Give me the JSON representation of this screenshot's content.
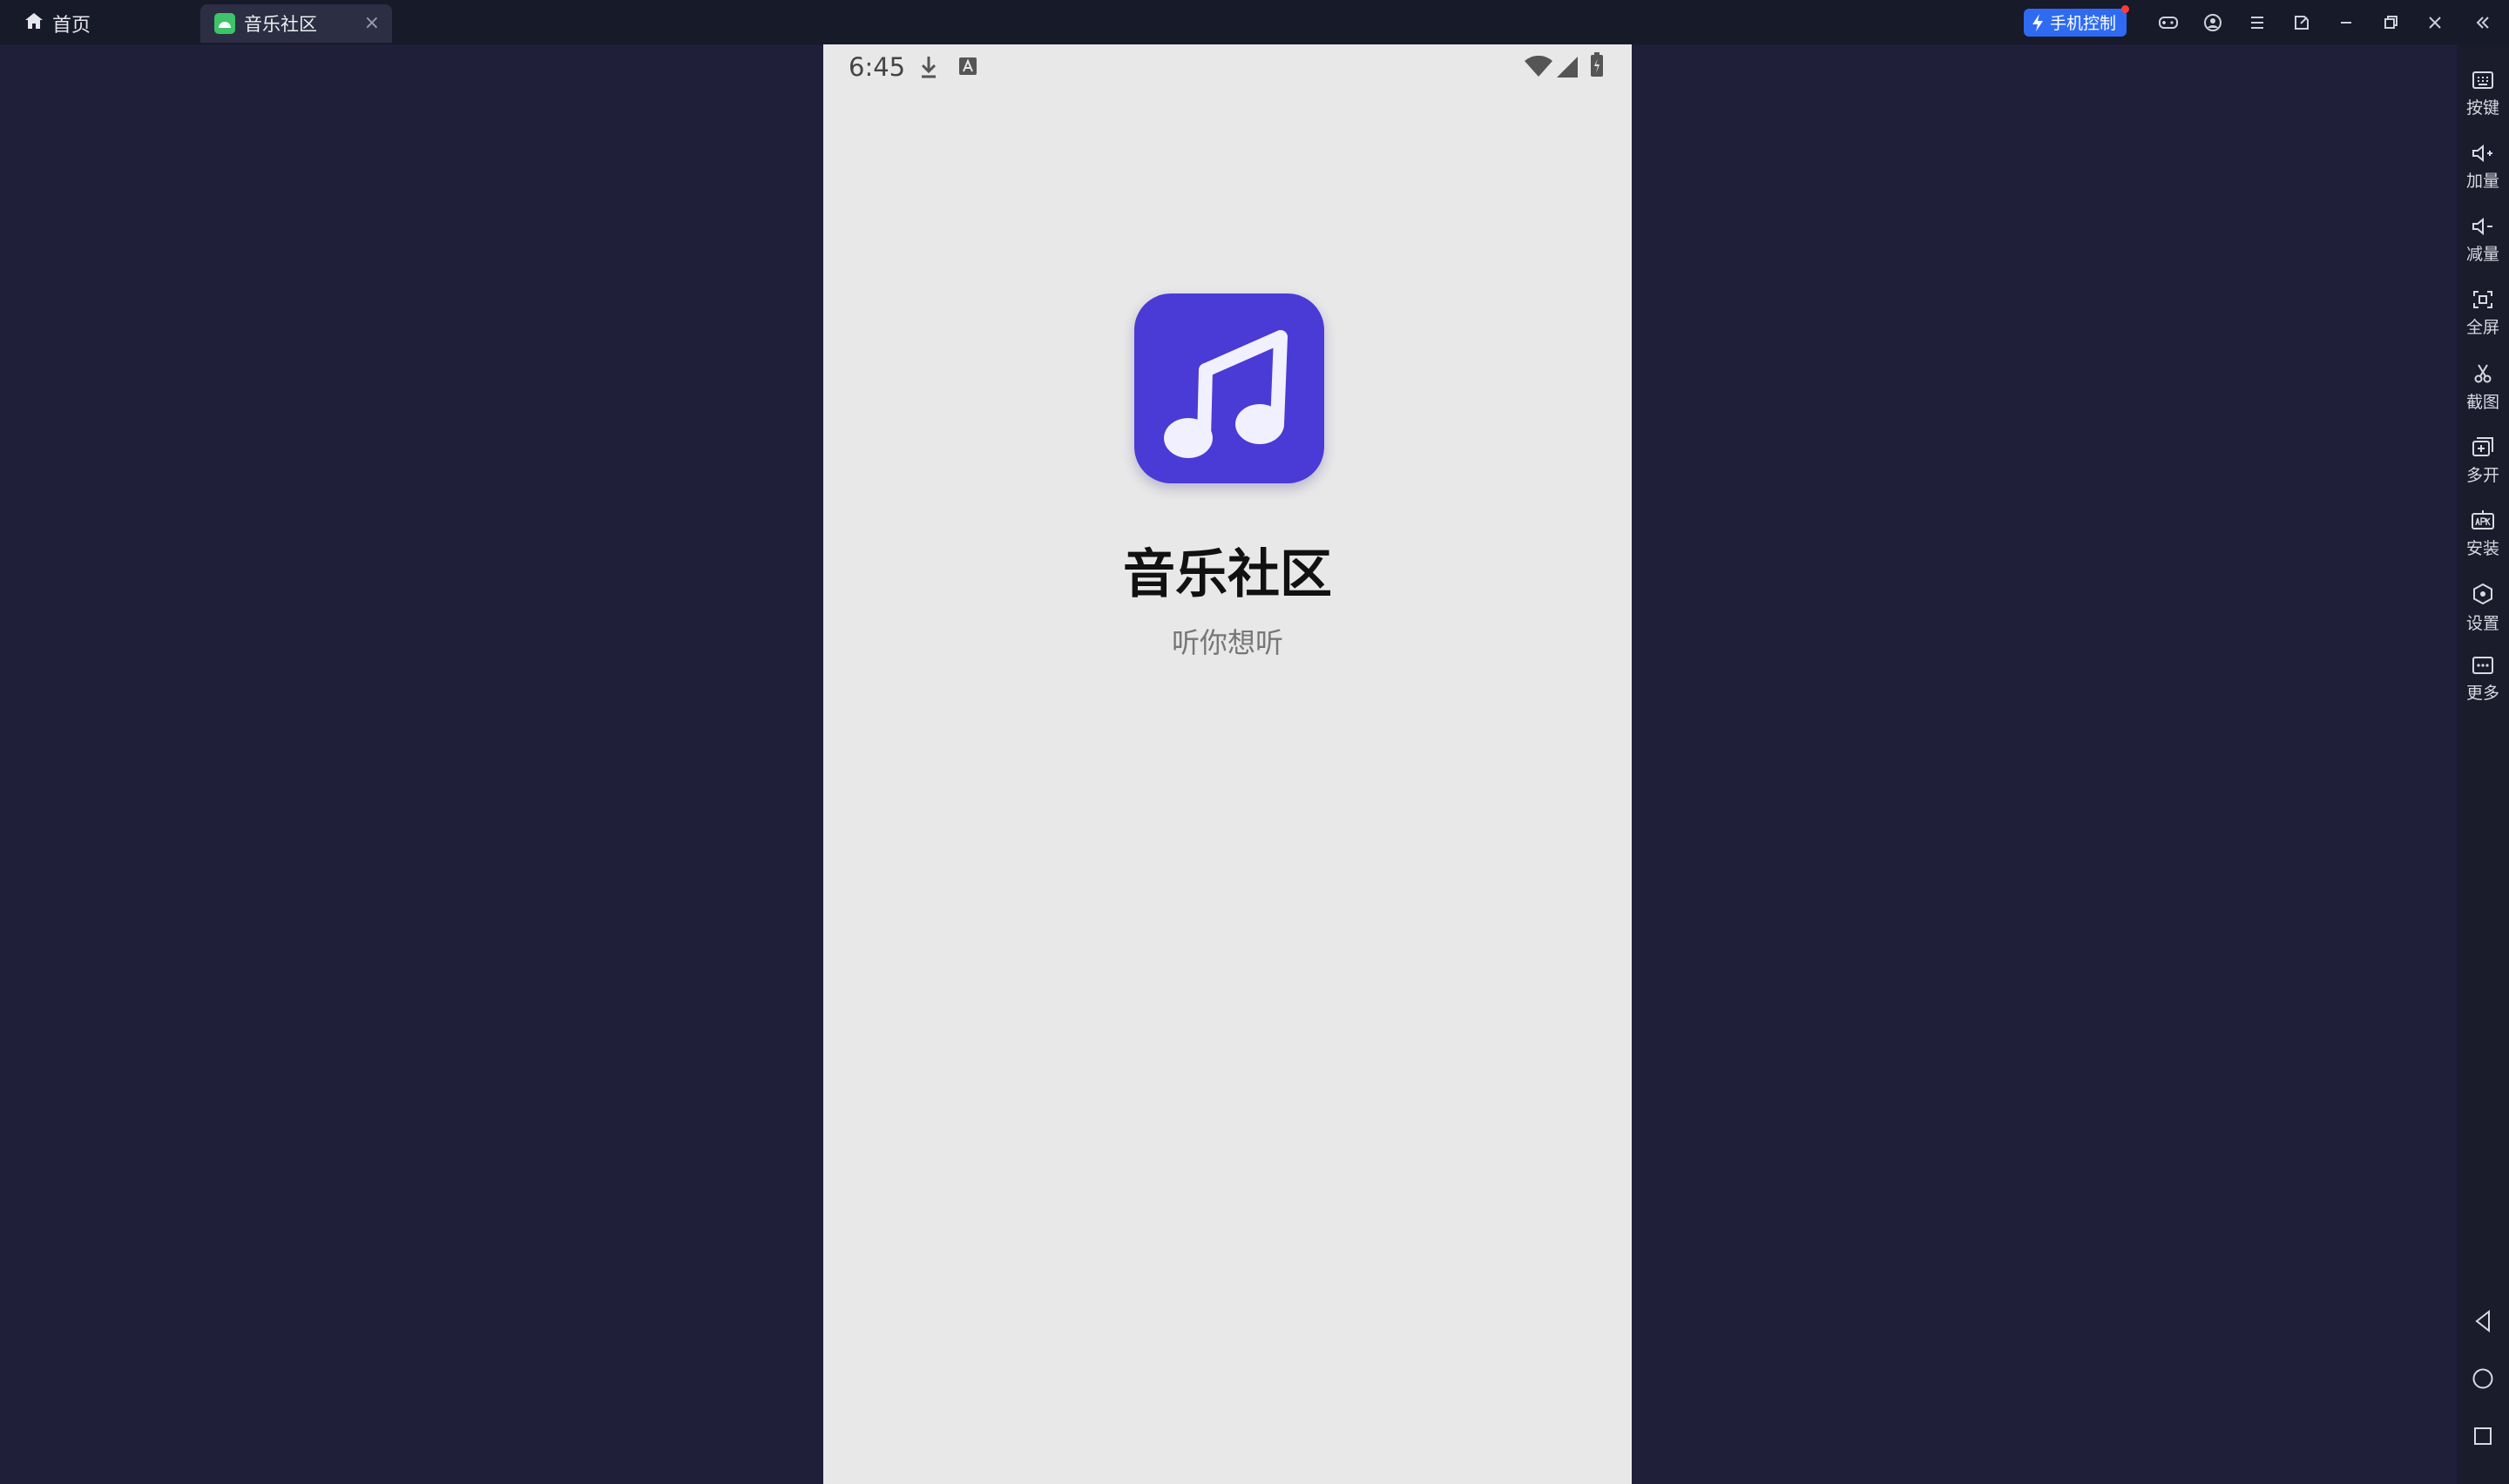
{
  "titlebar": {
    "home_tab": {
      "label": "首页",
      "icon": "home-icon"
    },
    "active_tab": {
      "label": "音乐社区",
      "icon": "android-icon",
      "close": "×"
    },
    "phone_control": "手机控制",
    "buttons": [
      "gamepad-icon",
      "user-icon",
      "menu-icon",
      "popout-icon",
      "minimize-icon",
      "restore-icon",
      "close-icon",
      "collapse-icon"
    ]
  },
  "phone": {
    "status_bar": {
      "time": "6:45",
      "left_icons": [
        "download-icon",
        "notification-a-icon"
      ],
      "right_icons": [
        "wifi-icon",
        "signal-icon",
        "battery-charging-icon"
      ]
    },
    "app": {
      "title": "音乐社区",
      "subtitle": "听你想听",
      "icon": "music-note-icon",
      "icon_color": "#4a3ad6"
    }
  },
  "sidebar": {
    "items": [
      {
        "label": "按键",
        "icon": "keyboard-icon"
      },
      {
        "label": "加量",
        "icon": "volume-up-icon"
      },
      {
        "label": "减量",
        "icon": "volume-down-icon"
      },
      {
        "label": "全屏",
        "icon": "fullscreen-icon"
      },
      {
        "label": "截图",
        "icon": "scissors-icon"
      },
      {
        "label": "多开",
        "icon": "multi-instance-icon"
      },
      {
        "label": "安装",
        "icon": "apk-install-icon"
      },
      {
        "label": "设置",
        "icon": "settings-icon"
      },
      {
        "label": "更多",
        "icon": "more-icon"
      }
    ],
    "nav": [
      "back-icon",
      "home-circle-icon",
      "recents-icon"
    ]
  },
  "colors": {
    "background": "#1f1f3a",
    "titlebar": "#171a29",
    "phone_screen": "#e8e8e8",
    "accent": "#2f6bf2"
  }
}
